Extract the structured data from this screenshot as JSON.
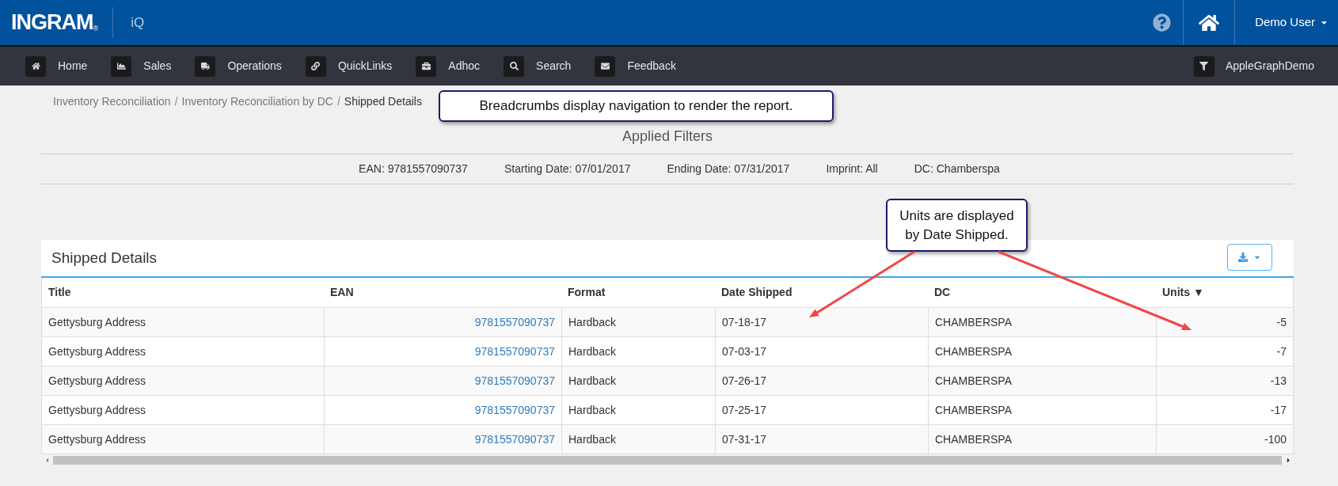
{
  "header": {
    "logo": "INGRAM",
    "logo_mark": "®",
    "app_name": "iQ",
    "user_menu": "Demo User"
  },
  "nav": {
    "items": [
      "Home",
      "Sales",
      "Operations",
      "QuickLinks",
      "Adhoc",
      "Search",
      "Feedback"
    ],
    "filter_label": "AppleGraphDemo"
  },
  "breadcrumbs": [
    {
      "label": "Inventory Reconciliation",
      "separator": "/",
      "current": false
    },
    {
      "label": "Inventory Reconciliation by DC",
      "separator": "/",
      "current": false
    },
    {
      "label": "Shipped Details",
      "current": true
    }
  ],
  "callouts": [
    {
      "text": "Breadcrumbs display navigation to render the report."
    },
    {
      "text": "Units are displayed by Date Shipped."
    }
  ],
  "applied_filters": {
    "title": "Applied Filters",
    "items": [
      "EAN: 9781557090737",
      "Starting Date: 07/01/2017",
      "Ending Date: 07/31/2017",
      "Imprint: All",
      "DC: Chamberspa"
    ]
  },
  "panel": {
    "title": "Shipped Details",
    "table": {
      "columns": [
        {
          "label": "Title",
          "kind": "text"
        },
        {
          "label": "EAN",
          "kind": "link"
        },
        {
          "label": "Format",
          "kind": "text"
        },
        {
          "label": "Date Shipped",
          "kind": "text"
        },
        {
          "label": "DC",
          "kind": "text"
        },
        {
          "label": "Units",
          "kind": "number",
          "sort_indicator": "▼"
        }
      ],
      "rows": [
        [
          "Gettysburg Address",
          "9781557090737",
          "Hardback",
          "07-18-17",
          "CHAMBERSPA",
          "-5"
        ],
        [
          "Gettysburg Address",
          "9781557090737",
          "Hardback",
          "07-03-17",
          "CHAMBERSPA",
          "-7"
        ],
        [
          "Gettysburg Address",
          "9781557090737",
          "Hardback",
          "07-26-17",
          "CHAMBERSPA",
          "-13"
        ],
        [
          "Gettysburg Address",
          "9781557090737",
          "Hardback",
          "07-25-17",
          "CHAMBERSPA",
          "-17"
        ],
        [
          "Gettysburg Address",
          "9781557090737",
          "Hardback",
          "07-31-17",
          "CHAMBERSPA",
          "-100"
        ]
      ]
    }
  }
}
